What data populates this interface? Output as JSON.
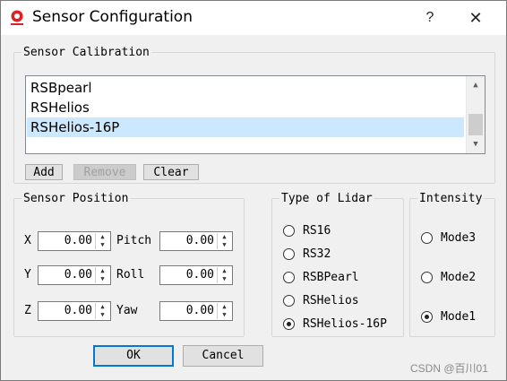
{
  "window": {
    "title": "Sensor Configuration",
    "help_glyph": "?",
    "close_glyph": "✕"
  },
  "calibration": {
    "legend": "Sensor Calibration",
    "items": [
      "RSBpearl",
      "RSHelios",
      "RSHelios-16P"
    ],
    "selected": "RSHelios-16P",
    "add_label": "Add",
    "remove_label": "Remove",
    "clear_label": "Clear"
  },
  "position": {
    "legend": "Sensor Position",
    "fields": [
      {
        "label": "X",
        "value": "0.00"
      },
      {
        "label": "Y",
        "value": "0.00"
      },
      {
        "label": "Z",
        "value": "0.00"
      },
      {
        "label": "Pitch",
        "value": "0.00"
      },
      {
        "label": "Roll",
        "value": "0.00"
      },
      {
        "label": "Yaw",
        "value": "0.00"
      }
    ]
  },
  "lidar": {
    "legend": "Type of Lidar",
    "options": [
      "RS16",
      "RS32",
      "RSBPearl",
      "RSHelios",
      "RSHelios-16P"
    ],
    "selected": "RSHelios-16P"
  },
  "intensity": {
    "legend": "Intensity",
    "options": [
      "Mode3",
      "Mode2",
      "Mode1"
    ],
    "selected": "Mode1"
  },
  "footer": {
    "ok_label": "OK",
    "cancel_label": "Cancel"
  },
  "watermark": "CSDN @百川01",
  "colors": {
    "selection": "#cce8ff",
    "default_button_border": "#0078d7"
  }
}
